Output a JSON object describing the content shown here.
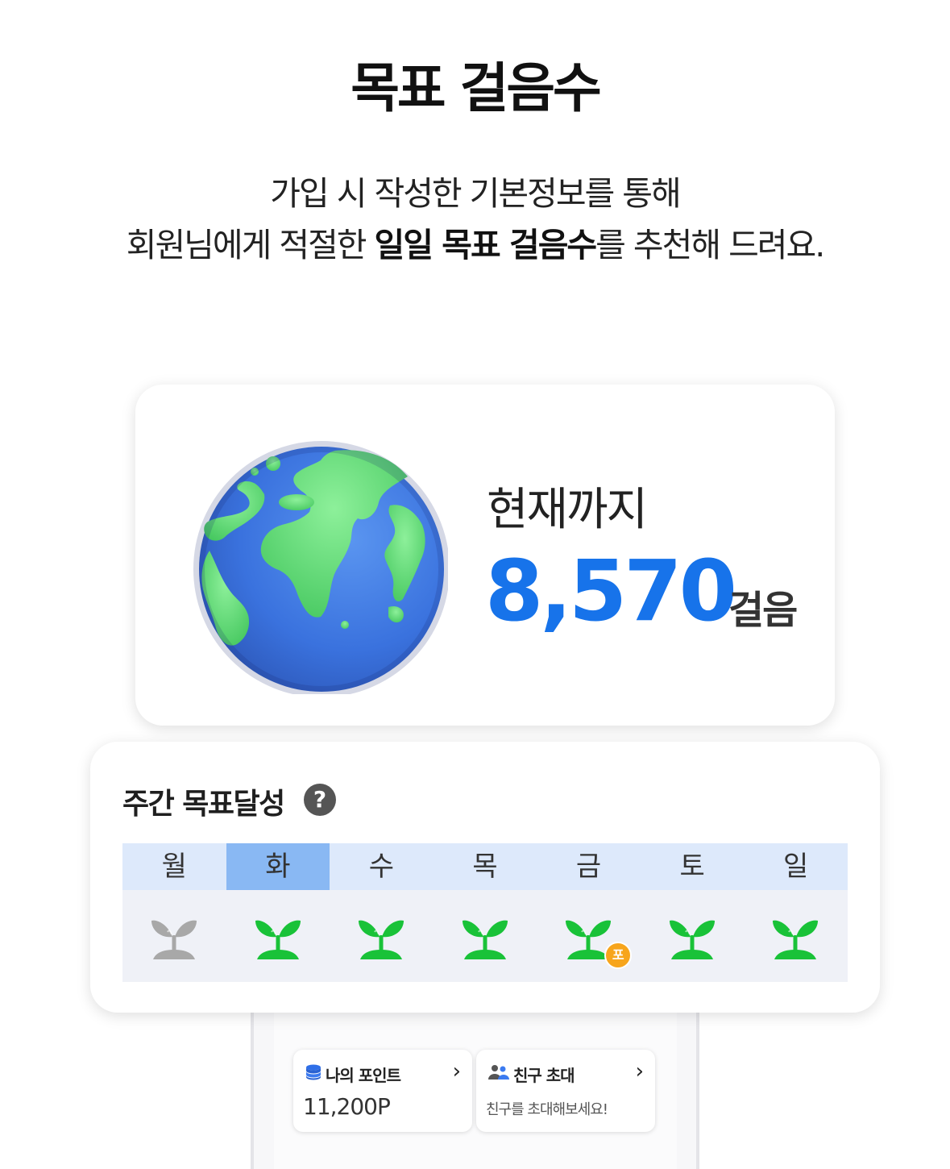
{
  "header": {
    "title": "목표 걸음수",
    "line1": "가입 시 작성한 기본정보를 통해",
    "line2_pre": "회원님에게 적절한 ",
    "line2_bold": "일일 목표 걸음수",
    "line2_post": "를 추천해 드려요."
  },
  "steps_card": {
    "label": "현재까지",
    "value": "8,570",
    "unit": "걸음",
    "image_icon": "earth-globe"
  },
  "weekly": {
    "title": "주간 목표달성",
    "help_symbol": "?",
    "days": [
      "월",
      "화",
      "수",
      "목",
      "금",
      "토",
      "일"
    ],
    "active_day": "화",
    "achieved": [
      false,
      true,
      true,
      true,
      true,
      true,
      true
    ],
    "badge_day": "금",
    "badge_text": "포"
  },
  "points_card": {
    "label": "나의 포인트",
    "value": "11,200P",
    "icon": "coin-stack-icon"
  },
  "invite_card": {
    "label": "친구 초대",
    "text": "친구를 초대해보세요!",
    "icon": "people-icon"
  },
  "colors": {
    "accent_blue": "#1773ea",
    "sprout_green": "#19c238",
    "sprout_gray": "#a8a8a8",
    "active_day_bg": "#89b8f3",
    "day_row_bg": "#dde9fb",
    "badge_orange": "#f7a51c"
  }
}
